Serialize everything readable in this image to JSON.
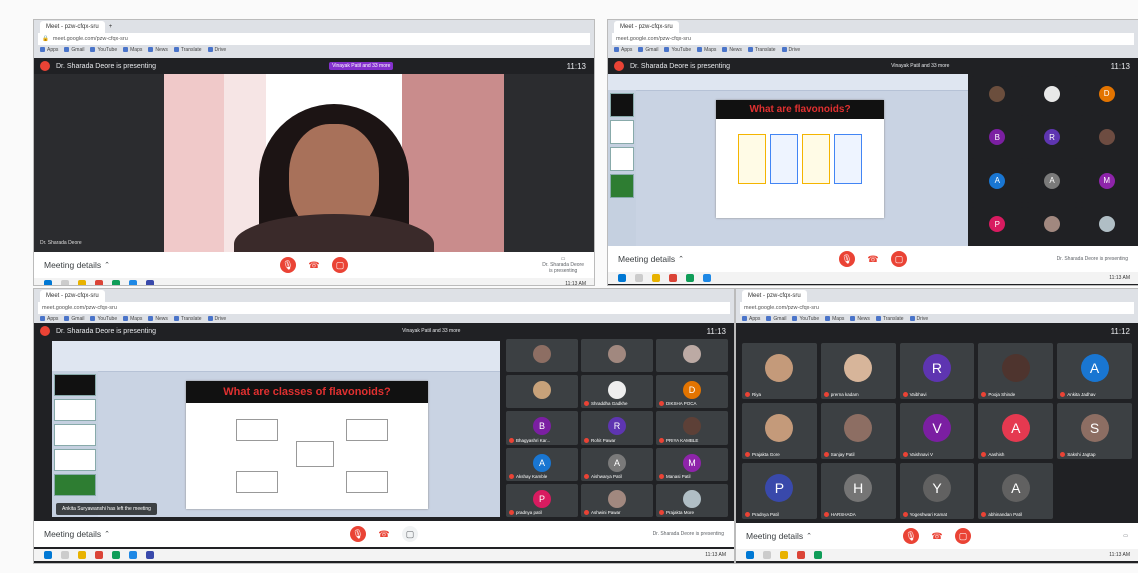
{
  "q1": {
    "presenting": "Dr. Sharada Deore is presenting",
    "clock": "11:13",
    "self_label": "Dr. Sharada Deore",
    "meeting_details": "Meeting details",
    "participant_chip": "Vinayak Patil and 33 more"
  },
  "q2": {
    "presenting": "Dr. Sharada Deore is presenting",
    "clock": "11:13",
    "slide_title": "What are flavonoids?",
    "meeting_details": "Meeting details",
    "chip": "Vinayak Patil and 33 more",
    "presenter_caption": "Dr. Sharada Deore is presenting",
    "avatars": [
      {
        "letter": "",
        "color": "#6b4e3d"
      },
      {
        "letter": "",
        "color": "#e8e8e8"
      },
      {
        "letter": "D",
        "color": "#e37400"
      },
      {
        "letter": "B",
        "color": "#7b1fa2"
      },
      {
        "letter": "R",
        "color": "#5e35b1"
      },
      {
        "letter": "",
        "color": "#6d4c41"
      },
      {
        "letter": "A",
        "color": "#1976d2"
      },
      {
        "letter": "A",
        "color": "#7a7a7a"
      },
      {
        "letter": "M",
        "color": "#8e24aa"
      },
      {
        "letter": "P",
        "color": "#d81b60"
      },
      {
        "letter": "",
        "color": "#a1887f"
      },
      {
        "letter": "",
        "color": "#b0bec5"
      }
    ]
  },
  "q3": {
    "presenting": "Dr. Sharada Deore is presenting",
    "clock": "11:13",
    "slide_title": "What are classes of flavonoids?",
    "toast": "Ankita Suryawanshi has left the meeting",
    "meeting_details": "Meeting details",
    "chip": "Vinayak Patil and 33 more",
    "presenter_caption": "Dr. Sharada Deore is presenting",
    "tiles": [
      {
        "name": "",
        "letter": "",
        "color": "#8d6e63"
      },
      {
        "name": "",
        "letter": "",
        "color": "#a1887f"
      },
      {
        "name": "",
        "letter": "",
        "color": "#bcaaa4"
      },
      {
        "name": "",
        "letter": "",
        "color": "#c8a27a"
      },
      {
        "name": "Shraddha Gadkhe",
        "letter": "",
        "color": "#eeeeee"
      },
      {
        "name": "DIKSHA POCA",
        "letter": "D",
        "color": "#e37400"
      },
      {
        "name": "Bhagyashri Kar...",
        "letter": "B",
        "color": "#7b1fa2"
      },
      {
        "name": "Rohit Pawar",
        "letter": "R",
        "color": "#5e35b1"
      },
      {
        "name": "PRIYA KAMBLE",
        "letter": "",
        "color": "#5d4037"
      },
      {
        "name": "Akshay Kamble",
        "letter": "A",
        "color": "#1976d2"
      },
      {
        "name": "Aishwarya Patil",
        "letter": "A",
        "color": "#7a7a7a"
      },
      {
        "name": "Manasi Patil",
        "letter": "M",
        "color": "#8e24aa"
      },
      {
        "name": "pradnya patil",
        "letter": "P",
        "color": "#d81b60"
      },
      {
        "name": "Ashwini Pawar",
        "letter": "",
        "color": "#a1887f"
      },
      {
        "name": "Prajakta More",
        "letter": "",
        "color": "#b0bec5"
      }
    ]
  },
  "q4": {
    "clock": "11:12",
    "meeting_details": "Meeting details",
    "tiles": [
      {
        "name": "Riya",
        "letter": "",
        "color": "#c49a7a"
      },
      {
        "name": "prerna kadam",
        "letter": "",
        "color": "#d7b59a"
      },
      {
        "name": "Vaibhavi",
        "letter": "R",
        "color": "#5e35b1"
      },
      {
        "name": "Pooja Shinde",
        "letter": "",
        "color": "#4e342e"
      },
      {
        "name": "Ankita Jadhav",
        "letter": "A",
        "color": "#1976d2"
      },
      {
        "name": "Prajakta Gore",
        "letter": "",
        "color": "#c49a7a"
      },
      {
        "name": "Sanjay Patil",
        "letter": "",
        "color": "#8d6e63"
      },
      {
        "name": "Vaishnavi V",
        "letter": "V",
        "color": "#7b1fa2"
      },
      {
        "name": "Aashish",
        "letter": "A",
        "color": "#e53950"
      },
      {
        "name": "Sakshi Jagtap",
        "letter": "S",
        "color": "#8d6e63"
      },
      {
        "name": "Pradnya Patil",
        "letter": "P",
        "color": "#3949ab"
      },
      {
        "name": "HARSHADA",
        "letter": "H",
        "color": "#757575"
      },
      {
        "name": "Yogeshwari Kamat",
        "letter": "Y",
        "color": "#616161"
      },
      {
        "name": "abhinandan Patil",
        "letter": "A",
        "color": "#616161"
      }
    ]
  },
  "browser": {
    "tab": "Meet - pzw-cfqx-sru",
    "url": "meet.google.com/pzw-cfqx-sru",
    "bookmarks": [
      "Apps",
      "Gmail",
      "YouTube",
      "Maps",
      "News",
      "Translate",
      "Drive"
    ]
  },
  "taskbar_time": "11:13 AM",
  "colors": {
    "meet_dark": "#202124",
    "end_red": "#ea4335",
    "slide_title_red": "#e03030"
  }
}
